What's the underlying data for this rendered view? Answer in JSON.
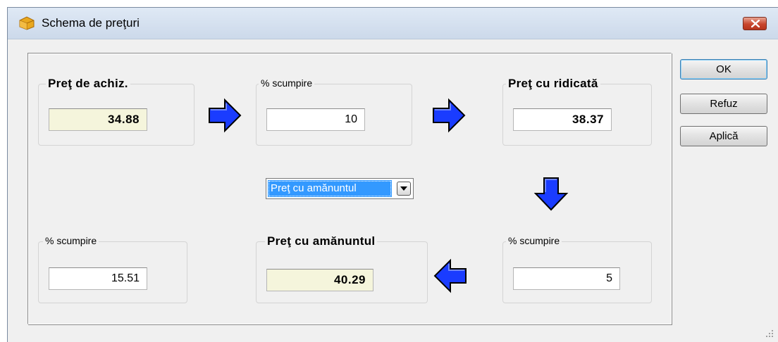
{
  "window": {
    "title": "Schema de preţuri",
    "icon": "package-icon"
  },
  "fields": {
    "purchase_price": {
      "label": "Preţ de achiz.",
      "value": "34.88"
    },
    "markup_1": {
      "label": "% scumpire",
      "value": "10"
    },
    "wholesale_price": {
      "label": "Preţ cu ridicată",
      "value": "38.37"
    },
    "markup_3": {
      "label": "% scumpire",
      "value": "15.51"
    },
    "retail_price": {
      "label": "Preţ cu amănuntul",
      "value": "40.29"
    },
    "markup_2": {
      "label": "% scumpire",
      "value": "5"
    }
  },
  "combo": {
    "selected": "Preţ cu amănuntul",
    "icon": "chevron-down-icon"
  },
  "buttons": {
    "ok": "OK",
    "cancel": "Refuz",
    "apply": "Aplică"
  },
  "colors": {
    "arrow_fill": "#1a3cff",
    "readonly_bg": "#f5f5dc",
    "selection": "#3399ff"
  }
}
